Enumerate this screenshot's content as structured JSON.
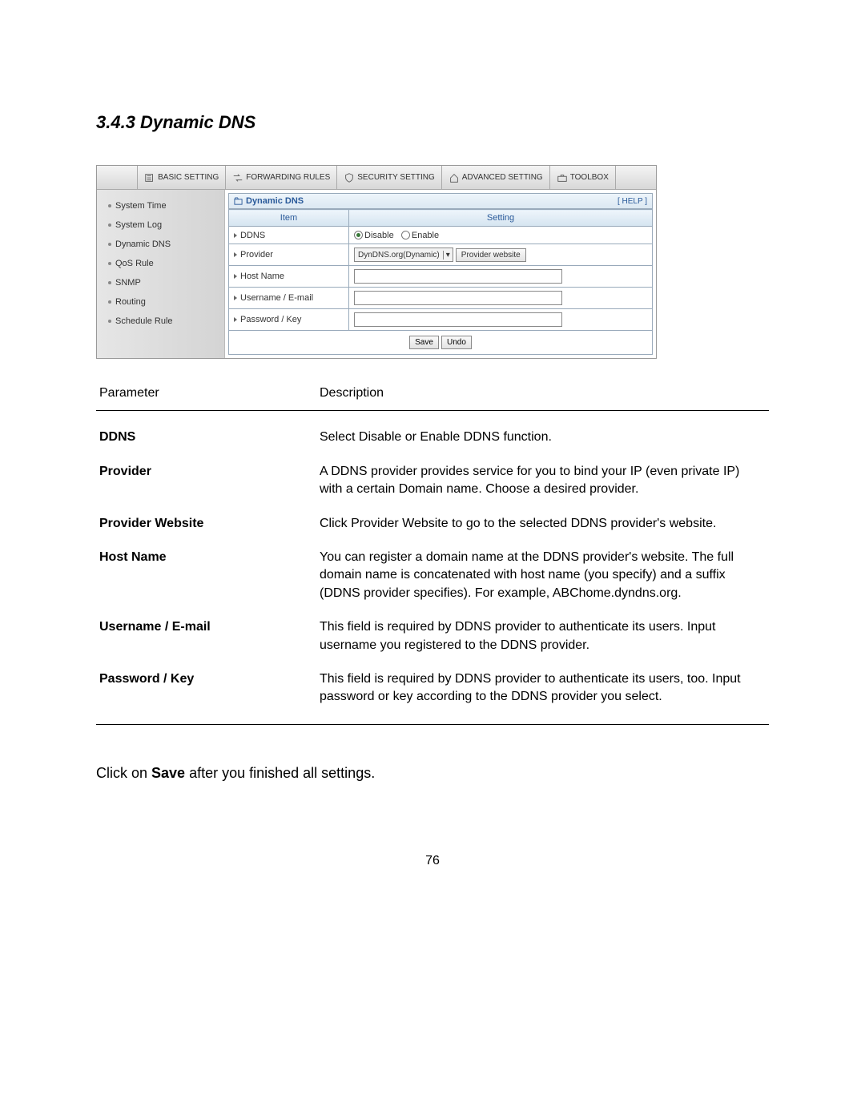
{
  "section_title": "3.4.3 Dynamic DNS",
  "tabs": {
    "basic": "BASIC SETTING",
    "forwarding": "FORWARDING RULES",
    "security": "SECURITY SETTING",
    "advanced": "ADVANCED SETTING",
    "toolbox": "TOOLBOX"
  },
  "sidebar": {
    "items": [
      "System Time",
      "System Log",
      "Dynamic DNS",
      "QoS Rule",
      "SNMP",
      "Routing",
      "Schedule Rule"
    ]
  },
  "panel": {
    "title": "Dynamic DNS",
    "help": "[ HELP ]",
    "col_item": "Item",
    "col_setting": "Setting",
    "rows": {
      "ddns": "DDNS",
      "provider": "Provider",
      "hostname": "Host Name",
      "username": "Username / E-mail",
      "password": "Password / Key"
    },
    "ddns_options": {
      "disable": "Disable",
      "enable": "Enable"
    },
    "provider_select": "DynDNS.org(Dynamic)",
    "provider_website_btn": "Provider website",
    "save_btn": "Save",
    "undo_btn": "Undo"
  },
  "desc_header": {
    "param": "Parameter",
    "desc": "Description"
  },
  "desc_rows": [
    {
      "param": "DDNS",
      "desc": "Select Disable or Enable DDNS function."
    },
    {
      "param": "Provider",
      "desc": "A DDNS provider provides service for you to bind your IP (even private IP) with a certain Domain name. Choose a desired provider."
    },
    {
      "param": "Provider Website",
      "desc": "Click Provider Website to go to the selected DDNS provider's website."
    },
    {
      "param": "Host Name",
      "desc": "You can register a domain name at the DDNS provider's website. The full domain name is concatenated with host name (you specify) and a suffix (DDNS provider specifies). For example, ABChome.dyndns.org."
    },
    {
      "param": "Username / E-mail",
      "desc": "This field is required by DDNS provider to authenticate its users. Input username you registered to the DDNS provider."
    },
    {
      "param": "Password / Key",
      "desc": "This field is required by DDNS provider to authenticate its users, too. Input password or key according to the DDNS provider you select."
    }
  ],
  "footer_note_pre": "Click on ",
  "footer_note_bold": "Save",
  "footer_note_post": " after you finished all settings.",
  "page_number": "76"
}
